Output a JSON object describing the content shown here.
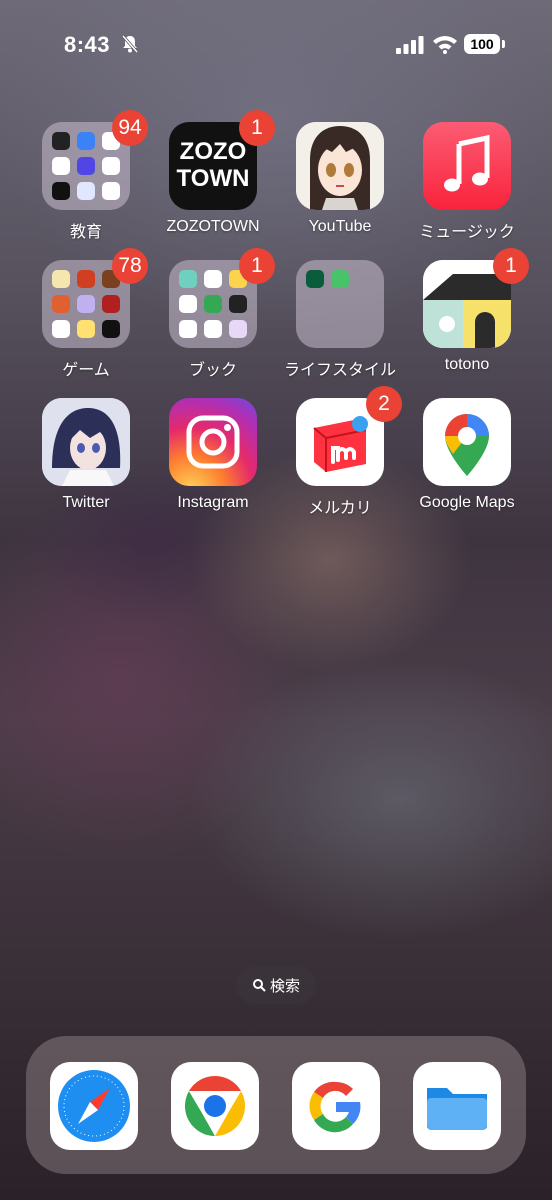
{
  "status_bar": {
    "time": "8:43",
    "battery": "100"
  },
  "apps": [
    {
      "label": "教育",
      "badge": "94"
    },
    {
      "label": "ZOZOTOWN",
      "badge": "1",
      "icon_text_1": "ZOZO",
      "icon_text_2": "TOWN"
    },
    {
      "label": "YouTube",
      "badge": ""
    },
    {
      "label": "ミュージック",
      "badge": ""
    },
    {
      "label": "ゲーム",
      "badge": "78"
    },
    {
      "label": "ブック",
      "badge": "1"
    },
    {
      "label": "ライフスタイル",
      "badge": ""
    },
    {
      "label": "totono",
      "badge": "1"
    },
    {
      "label": "Twitter",
      "badge": ""
    },
    {
      "label": "Instagram",
      "badge": ""
    },
    {
      "label": "メルカリ",
      "badge": "2"
    },
    {
      "label": "Google Maps",
      "badge": ""
    }
  ],
  "search": {
    "label": "検索"
  },
  "dock": [
    {
      "name": "safari"
    },
    {
      "name": "chrome"
    },
    {
      "name": "google"
    },
    {
      "name": "files"
    }
  ],
  "colors": {
    "badge": "#ea4335"
  }
}
